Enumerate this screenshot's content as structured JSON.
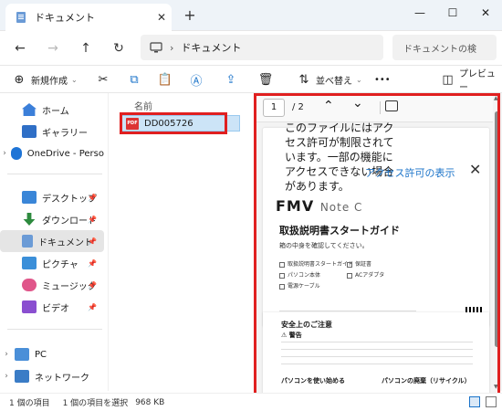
{
  "window": {
    "tab_title": "ドキュメント",
    "tab_close": "✕",
    "new_tab": "+",
    "minimize": "—",
    "maximize": "☐",
    "close": "✕"
  },
  "nav": {
    "back": "←",
    "forward": "→",
    "up": "↑",
    "refresh": "↻",
    "breadcrumb_sep": "›",
    "breadcrumb": "ドキュメント",
    "search_placeholder": "ドキュメントの検"
  },
  "toolbar": {
    "new_label": "新規作成",
    "sort_label": "並べ替え",
    "more": "•••",
    "preview_label": "プレビュー"
  },
  "sidebar": {
    "items": [
      {
        "label": "ホーム",
        "icon": "home-icon"
      },
      {
        "label": "ギャラリー",
        "icon": "gallery-icon"
      },
      {
        "label": "OneDrive - Perso",
        "icon": "cloud-icon"
      },
      {
        "label": "デスクトップ",
        "icon": "desktop-icon"
      },
      {
        "label": "ダウンロード",
        "icon": "download-icon"
      },
      {
        "label": "ドキュメント",
        "icon": "documents-icon"
      },
      {
        "label": "ピクチャ",
        "icon": "pictures-icon"
      },
      {
        "label": "ミュージック",
        "icon": "music-icon"
      },
      {
        "label": "ビデオ",
        "icon": "video-icon"
      },
      {
        "label": "PC",
        "icon": "pc-icon"
      },
      {
        "label": "ネットワーク",
        "icon": "network-icon"
      }
    ]
  },
  "filelist": {
    "column_name": "名前",
    "files": [
      {
        "name": "DD005726",
        "type": "PDF"
      }
    ]
  },
  "preview": {
    "page_current": "1",
    "page_total": "/ 2",
    "restricted_notice": "このファイルにはアクセス許可が制限されています。一部の機能にアクセスできない場合があります。",
    "access_link": "アクセス許可の表示",
    "banner_close": "✕",
    "doc_brand": "FMV",
    "doc_brand_sub": "Note C",
    "doc_title": "取扱説明書スタートガイド",
    "doc_subtitle": "箱の中身を確認してください。",
    "doc_checks": [
      "取扱説明書スタートガイド",
      "保証書",
      "パソコン本体",
      "ACアダプタ",
      "電源ケーブル"
    ],
    "doc2_title": "安全上のご注意",
    "doc2_warning": "警告",
    "doc2_section_left": "パソコンを使い始める",
    "doc2_section_right": "パソコンの廃棄（リサイクル）"
  },
  "status": {
    "item_count": "1 個の項目",
    "selected": "1 個の項目を選択",
    "size": "968 KB"
  }
}
